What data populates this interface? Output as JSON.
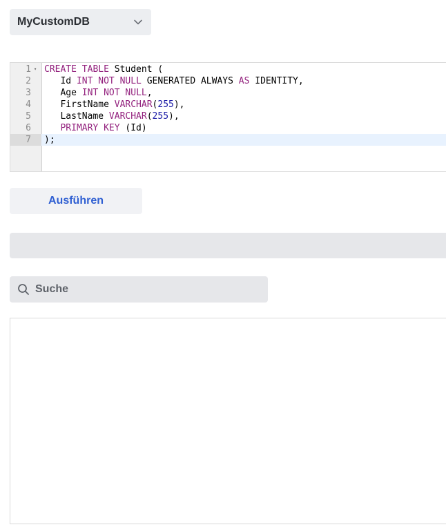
{
  "db_select": {
    "selected": "MyCustomDB",
    "chevron_icon": "chevron-down-icon"
  },
  "editor": {
    "lines": [
      {
        "number": "1",
        "foldable": true,
        "active": false,
        "tokens": [
          {
            "t": "CREATE TABLE",
            "c": "kw"
          },
          {
            "t": " Student (",
            "c": ""
          }
        ]
      },
      {
        "number": "2",
        "foldable": false,
        "active": false,
        "tokens": [
          {
            "t": "   Id ",
            "c": ""
          },
          {
            "t": "INT NOT NULL",
            "c": "kw"
          },
          {
            "t": " GENERATED ALWAYS ",
            "c": ""
          },
          {
            "t": "AS",
            "c": "kw"
          },
          {
            "t": " IDENTITY,",
            "c": ""
          }
        ]
      },
      {
        "number": "3",
        "foldable": false,
        "active": false,
        "tokens": [
          {
            "t": "   Age ",
            "c": ""
          },
          {
            "t": "INT NOT NULL",
            "c": "kw"
          },
          {
            "t": ",",
            "c": ""
          }
        ]
      },
      {
        "number": "4",
        "foldable": false,
        "active": false,
        "tokens": [
          {
            "t": "   FirstName ",
            "c": ""
          },
          {
            "t": "VARCHAR",
            "c": "kw"
          },
          {
            "t": "(",
            "c": ""
          },
          {
            "t": "255",
            "c": "num"
          },
          {
            "t": "),",
            "c": ""
          }
        ]
      },
      {
        "number": "5",
        "foldable": false,
        "active": false,
        "tokens": [
          {
            "t": "   LastName ",
            "c": ""
          },
          {
            "t": "VARCHAR",
            "c": "kw"
          },
          {
            "t": "(",
            "c": ""
          },
          {
            "t": "255",
            "c": "num"
          },
          {
            "t": "),",
            "c": ""
          }
        ]
      },
      {
        "number": "6",
        "foldable": false,
        "active": false,
        "tokens": [
          {
            "t": "   ",
            "c": ""
          },
          {
            "t": "PRIMARY KEY",
            "c": "kw"
          },
          {
            "t": " (Id)",
            "c": ""
          }
        ]
      },
      {
        "number": "7",
        "foldable": false,
        "active": true,
        "tokens": [
          {
            "t": ");",
            "c": ""
          }
        ]
      }
    ]
  },
  "execute_button": {
    "label": "Ausführen"
  },
  "search": {
    "placeholder": "Suche",
    "value": "",
    "icon": "search-icon"
  },
  "colors": {
    "keyword": "#93227e",
    "number": "#1a1aa6",
    "accent": "#2f5fd2"
  }
}
